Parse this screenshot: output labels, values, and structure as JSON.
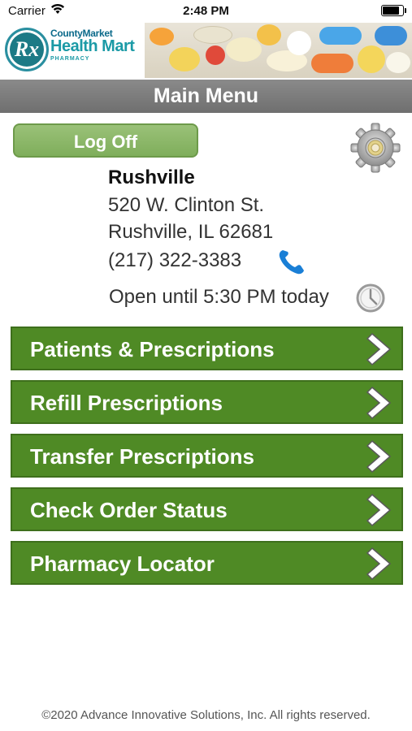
{
  "status_bar": {
    "carrier": "Carrier",
    "time": "2:48 PM",
    "battery_level": 0.9
  },
  "brand": {
    "line1": "CountyMarket",
    "line2": "Health Mart",
    "line3": "PHARMACY",
    "badge": "Rx"
  },
  "header": {
    "title": "Main Menu"
  },
  "actions": {
    "logoff_label": "Log Off"
  },
  "store": {
    "name": "Rushville",
    "address_line1": "520 W. Clinton St.",
    "address_line2": "Rushville, IL 62681",
    "phone": "(217) 322-3383",
    "hours": "Open until 5:30 PM today"
  },
  "menu": {
    "items": [
      {
        "label": "Patients & Prescriptions"
      },
      {
        "label": "Refill Prescriptions"
      },
      {
        "label": "Transfer Prescriptions"
      },
      {
        "label": "Check Order Status"
      },
      {
        "label": "Pharmacy Locator"
      }
    ]
  },
  "footer": {
    "copyright": "©2020 Advance Innovative Solutions, Inc. All rights reserved."
  },
  "colors": {
    "menu_green": "#4f8a25",
    "title_gray": "#7b7b7b",
    "logoff_green": "#8cb86a",
    "phone_blue": "#1a7fd6"
  },
  "icons": {
    "settings": "gear-icon",
    "phone": "phone-icon",
    "hours": "clock-icon",
    "menu_arrow": "chevron-right-icon"
  }
}
